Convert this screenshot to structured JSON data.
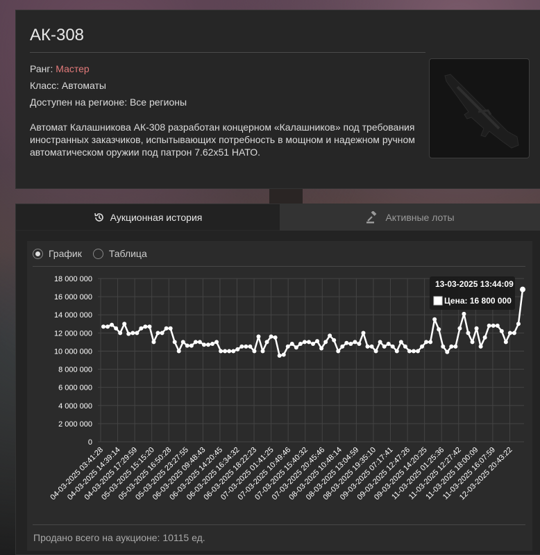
{
  "item": {
    "title": "АК-308",
    "rank_label": "Ранг:",
    "rank_value": "Мастер",
    "class_text": "Класс: Автоматы",
    "region_text": "Доступен на регионе: Все регионы",
    "description": "Автомат Калашникова АК-308 разработан концерном «Калашников» под требования иностранных заказчиков, испытывающих потребность в мощном и надежном ручном автоматическом оружии под патрон 7.62x51 НАТО."
  },
  "tabs": [
    {
      "label": "Аукционная история",
      "icon": "history-icon",
      "active": true
    },
    {
      "label": "Активные лоты",
      "icon": "gavel-icon",
      "active": false
    }
  ],
  "view_options": [
    {
      "label": "График",
      "selected": true
    },
    {
      "label": "Таблица",
      "selected": false
    }
  ],
  "tooltip": {
    "date": "13-03-2025 13:44:09",
    "label": "Цена: 16 800 000"
  },
  "footer": "Продано всего на аукционе: 10115 ед.",
  "colors": {
    "accent_rank": "#e27a7a",
    "line": "#ffffff"
  },
  "chart_data": {
    "type": "line",
    "ylim": [
      0,
      18000000
    ],
    "y_ticks": [
      0,
      2000000,
      4000000,
      6000000,
      8000000,
      10000000,
      12000000,
      14000000,
      16000000,
      18000000
    ],
    "y_tick_labels": [
      "0",
      "2 000 000",
      "4 000 000",
      "6 000 000",
      "8 000 000",
      "10 000 000",
      "12 000 000",
      "14 000 000",
      "16 000 000",
      "18 000 000"
    ],
    "x_tick_labels": [
      "04-03-2025 03:41:28",
      "04-03-2025 14:39:14",
      "04-03-2025 17:29:59",
      "05-03-2025 15:15:20",
      "05-03-2025 16:50:28",
      "05-03-2025 23:27:55",
      "06-03-2025 09:48:43",
      "06-03-2025 14:20:45",
      "06-03-2025 16:34:32",
      "06-03-2025 18:22:23",
      "07-03-2025 01:41:25",
      "07-03-2025 10:49:46",
      "07-03-2025 15:40:32",
      "07-03-2025 20:45:46",
      "08-03-2025 10:48:14",
      "08-03-2025 13:04:59",
      "08-03-2025 19:35:10",
      "09-03-2025 07:17:41",
      "09-03-2025 12:47:26",
      "09-03-2025 14:20:25",
      "11-03-2025 01:25:36",
      "11-03-2025 12:27:42",
      "11-03-2025 18:00:09",
      "11-03-2025 16:07:59",
      "12-03-2025 20:43:22"
    ],
    "values": [
      12700000,
      12700000,
      12900000,
      12500000,
      12000000,
      13000000,
      11900000,
      12000000,
      12000000,
      12500000,
      12700000,
      12700000,
      11000000,
      12000000,
      12000000,
      12500000,
      12500000,
      11000000,
      10000000,
      11000000,
      10600000,
      10600000,
      11000000,
      11000000,
      10700000,
      10700000,
      10800000,
      11000000,
      10000000,
      10000000,
      10000000,
      10000000,
      10200000,
      10500000,
      10500000,
      10500000,
      10000000,
      11600000,
      10000000,
      11000000,
      11600000,
      11500000,
      9500000,
      9600000,
      10500000,
      10800000,
      10400000,
      10800000,
      11000000,
      11000000,
      10800000,
      11100000,
      10300000,
      11000000,
      11700000,
      11200000,
      10000000,
      10500000,
      10900000,
      10800000,
      11000000,
      10800000,
      12000000,
      10500000,
      10500000,
      10000000,
      11000000,
      10500000,
      10800000,
      10500000,
      10000000,
      11000000,
      10500000,
      10000000,
      10000000,
      10000000,
      10500000,
      11000000,
      11000000,
      13500000,
      12400000,
      10500000,
      9900000,
      10500000,
      10500000,
      12500000,
      14100000,
      12000000,
      11000000,
      12500000,
      10500000,
      11500000,
      12800000,
      12800000,
      12800000,
      12200000,
      11000000,
      12000000,
      12000000,
      13000000,
      16800000
    ]
  }
}
